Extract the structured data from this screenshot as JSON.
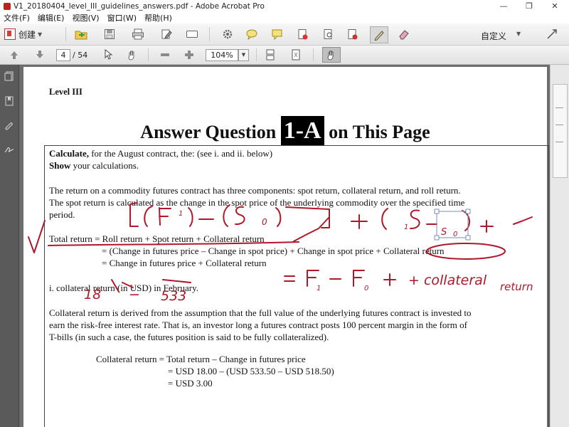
{
  "window": {
    "title": "V1_20180404_level_III_guidelines_answers.pdf - Adobe Acrobat Pro",
    "minimize_glyph": "—",
    "restore_glyph": "❐",
    "close_glyph": "✕"
  },
  "menu": {
    "items": [
      "文件(F)",
      "编辑(E)",
      "视图(V)",
      "窗口(W)",
      "帮助(H)"
    ]
  },
  "toolbar": {
    "create_label": "创建",
    "customize_label": "自定义"
  },
  "nav": {
    "page_current": "4",
    "page_total": "/ 54",
    "zoom": "104%"
  },
  "panels": {
    "tools": "工具",
    "sign": "签名",
    "comment": "注释"
  },
  "document": {
    "level": "Level III",
    "heading_prefix": "Answer Question ",
    "heading_num": "1-A",
    "heading_suffix": " on This Page",
    "calc_bold": "Calculate,",
    "calc_rest": " for the August contract, the: (see i. and ii. below)",
    "show_bold": "Show",
    "show_rest": " your calculations.",
    "para1_line1": "The return on a commodity futures contract has three components: spot return, collateral return, and roll return.",
    "para1_line2": "The spot return is calculated as the change in the spot price of the underlying commodity over the specified time",
    "para1_line3": "period.",
    "eq1": "Total return = Roll return + Spot return + Collateral return",
    "eq2": "= (Change in futures price – Change in spot price) + Change in spot price + Collateral return",
    "eq3": "= Change in futures price + Collateral return",
    "part_i": "i.  collateral return (in USD) in February.",
    "para2_line1": "Collateral return is derived from the assumption that the full value of the underlying futures contract is invested to",
    "para2_line2": "earn the risk-free interest rate. That is, an investor long a futures contract posts 100 percent margin in the form of",
    "para2_line3": "T-bills (in such a case, the futures position is said to be fully collateralized).",
    "calc1": "Collateral return = Total return – Change in futures price",
    "calc2": "= USD 18.00 – (USD 533.50 – USD 518.50)",
    "calc3": "= USD 3.00"
  },
  "annotations": {
    "ink_color": "#b0182a",
    "note_f": "F",
    "note_s": "S",
    "note_sub1": "1",
    "note_sub0": "0",
    "note_plus": "+",
    "note_eq": "= F",
    "note_minus": "− F",
    "note_collateral": "+  collateral",
    "note_return": "return",
    "note_18": "18",
    "note_dash": "−",
    "note_533": "533"
  }
}
